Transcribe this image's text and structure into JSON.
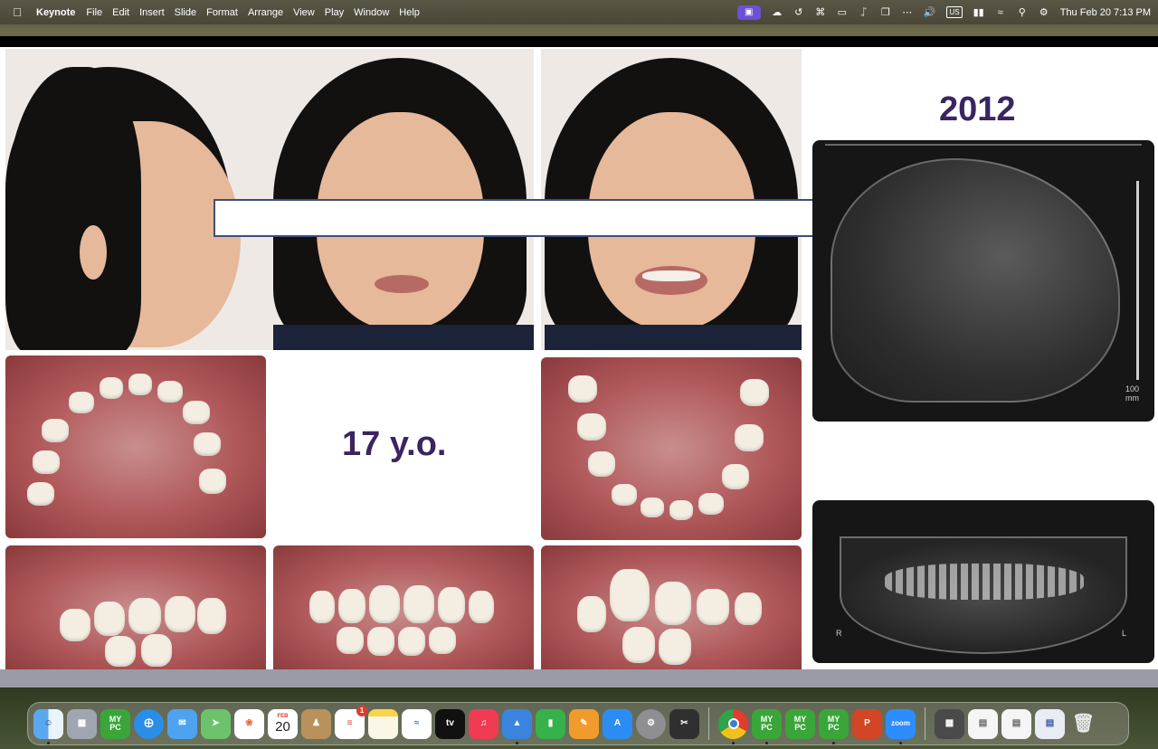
{
  "menubar": {
    "apple": "",
    "app_name": "Keynote",
    "menus": [
      "File",
      "Edit",
      "Insert",
      "Slide",
      "Format",
      "Arrange",
      "View",
      "Play",
      "Window",
      "Help"
    ],
    "keyboard_layout": "US",
    "clock": "Thu Feb 20  7:13 PM"
  },
  "slide": {
    "year_label": "2012",
    "age_label": "17 y.o.",
    "pano_left_label": "R",
    "pano_right_label": "L",
    "ceph_scale_label": "100 mm"
  },
  "dock": {
    "mypc_text_top": "MY",
    "mypc_text_bottom": "PC",
    "calendar_month": "FEB",
    "calendar_day": "20",
    "reminders_badge": "1",
    "appletv_label": "tv",
    "zoom_label": "zoom"
  },
  "colors": {
    "title_purple": "#3b2561",
    "redaction_border": "#3c4f7a",
    "mypc_green": "#3aa63a"
  }
}
